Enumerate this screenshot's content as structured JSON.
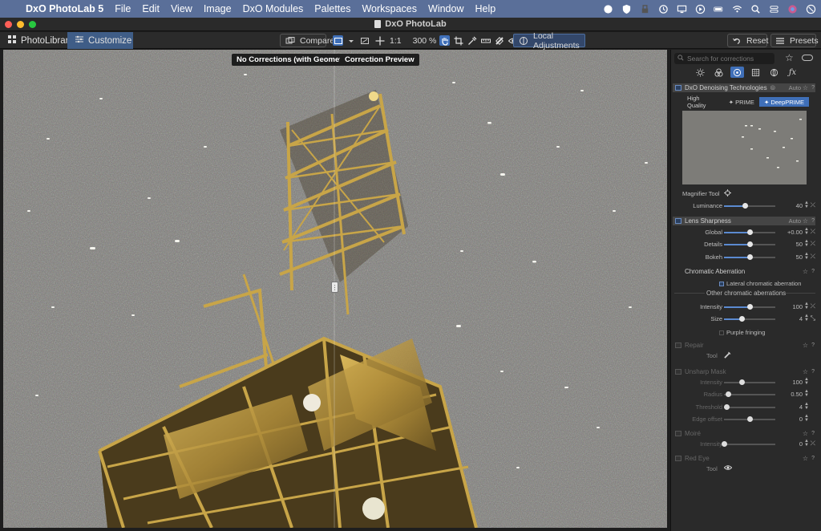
{
  "menubar": {
    "items": [
      "DxO PhotoLab 5",
      "File",
      "Edit",
      "View",
      "Image",
      "DxO Modules",
      "Palettes",
      "Workspaces",
      "Window",
      "Help"
    ]
  },
  "window": {
    "title": "DxO PhotoLab"
  },
  "toolbar": {
    "tab_library": "PhotoLibrary",
    "tab_customize": "Customize",
    "compare_label": "Compare",
    "one_to_one": "1:1",
    "zoom_value": "300 %",
    "local_adjustments_label": "Local Adjustments",
    "reset_label": "Reset",
    "presets_label": "Presets"
  },
  "viewer": {
    "left_tooltip": "No Corrections (with Geometry)",
    "right_tooltip": "Correction Preview"
  },
  "panel": {
    "search_placeholder": "Search for corrections",
    "denoising": {
      "title": "DxO Denoising Technologies",
      "auto": "Auto",
      "modes": [
        "High Quality",
        "PRIME",
        "DeepPRIME"
      ],
      "active_mode": "DeepPRIME",
      "magnifier_label": "Magnifier Tool",
      "luminance_label": "Luminance",
      "luminance_value": "40",
      "luminance_level": 0.4
    },
    "sharpness": {
      "title": "Lens Sharpness",
      "auto": "Auto",
      "global_label": "Global",
      "global_value": "+0.00",
      "global_level": 0.5,
      "details_label": "Details",
      "details_value": "50",
      "details_level": 0.5,
      "bokeh_label": "Bokeh",
      "bokeh_value": "50",
      "bokeh_level": 0.5
    },
    "chromatic": {
      "title": "Chromatic Aberration",
      "lateral_label": "Lateral chromatic aberration",
      "other_label": "Other chromatic aberrations",
      "intensity_label": "Intensity",
      "intensity_value": "100",
      "intensity_level": 0.5,
      "size_label": "Size",
      "size_value": "4",
      "size_level": 0.35,
      "purple_label": "Purple fringing"
    },
    "repair": {
      "title": "Repair",
      "tool_label": "Tool"
    },
    "unsharp": {
      "title": "Unsharp Mask",
      "intensity_label": "Intensity",
      "intensity_value": "100",
      "intensity_level": 0.35,
      "radius_label": "Radius",
      "radius_value": "0.50",
      "radius_level": 0.08,
      "threshold_label": "Threshold",
      "threshold_value": "4",
      "threshold_level": 0.05,
      "edge_label": "Edge offset",
      "edge_value": "0",
      "edge_level": 0.5
    },
    "moire": {
      "title": "Moiré",
      "intensity_label": "Intensity",
      "intensity_value": "0",
      "intensity_level": 0.0
    },
    "redeye": {
      "title": "Red Eye",
      "tool_label": "Tool"
    }
  }
}
